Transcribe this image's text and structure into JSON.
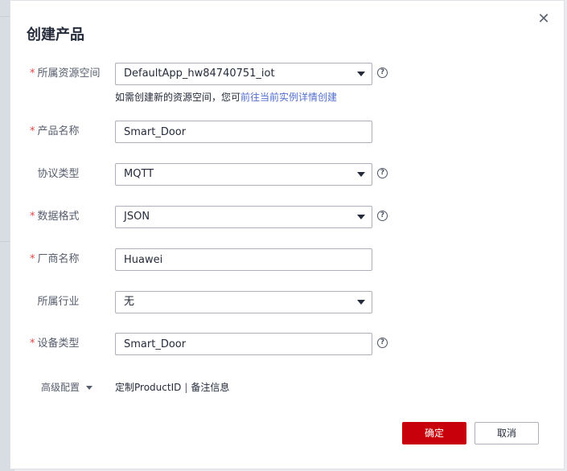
{
  "dialog": {
    "title": "创建产品",
    "close_glyph": "✕",
    "required_mark": "*",
    "help_glyph": "?"
  },
  "fields": {
    "resource_space": {
      "label": "所属资源空间",
      "value": "DefaultApp_hw84740751_iot",
      "required": true
    },
    "resource_hint": {
      "text": "如需创建新的资源空间，您可",
      "link": "前往当前实例详情创建"
    },
    "product_name": {
      "label": "产品名称",
      "value": "Smart_Door",
      "required": true
    },
    "protocol": {
      "label": "协议类型",
      "value": "MQTT",
      "required": false
    },
    "data_format": {
      "label": "数据格式",
      "value": "JSON",
      "required": true
    },
    "manufacturer": {
      "label": "厂商名称",
      "value": "Huawei",
      "required": true
    },
    "industry": {
      "label": "所属行业",
      "value": "无",
      "required": false
    },
    "device_type": {
      "label": "设备类型",
      "value": "Smart_Door",
      "required": true
    }
  },
  "advanced": {
    "label": "高级配置",
    "link_product_id": "定制ProductID",
    "separator": "|",
    "link_remark": "备注信息"
  },
  "buttons": {
    "ok": "确定",
    "cancel": "取消"
  },
  "colors": {
    "primary": "#c7000b",
    "link": "#526ecc",
    "required": "#e54545"
  }
}
